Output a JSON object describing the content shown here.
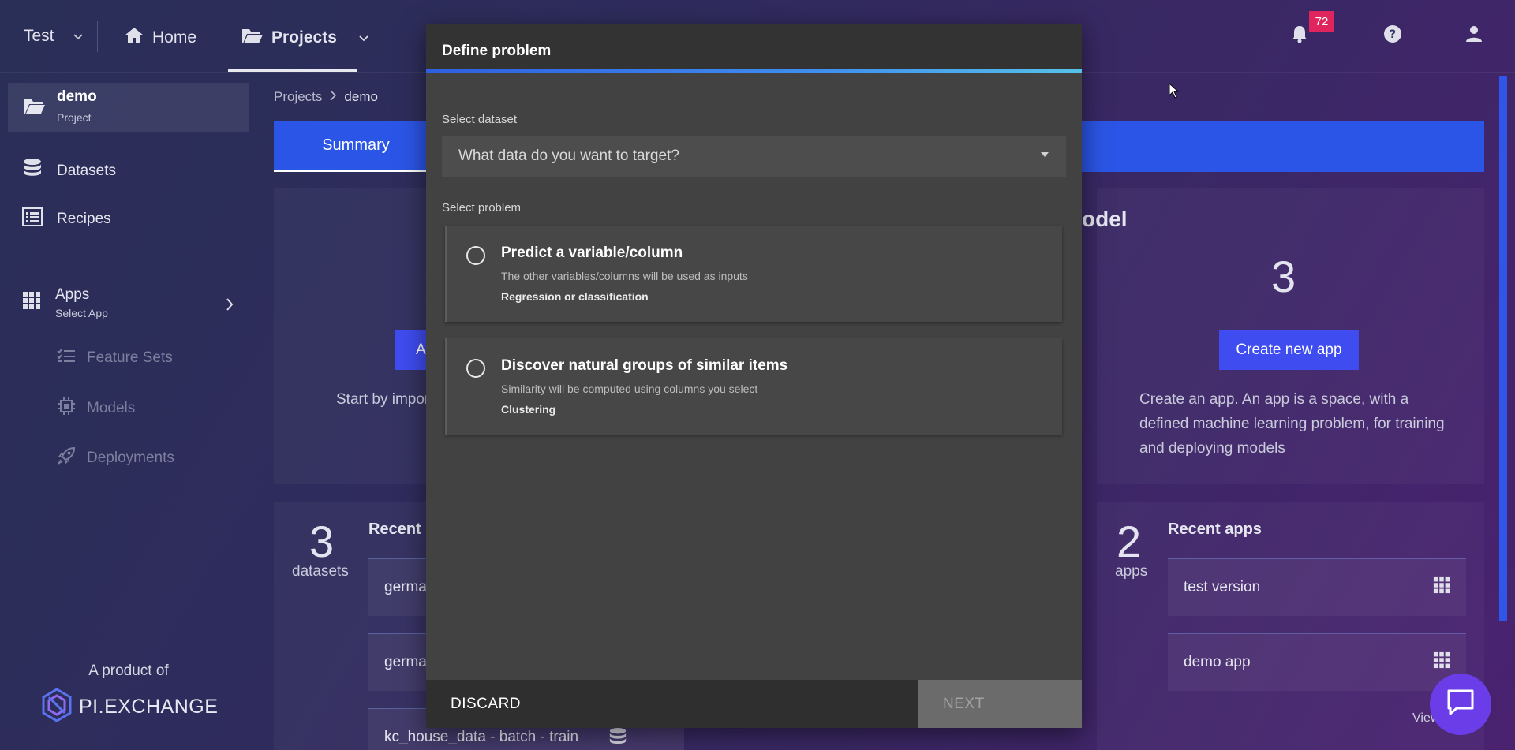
{
  "topbar": {
    "workspace": "Test",
    "home_label": "Home",
    "projects_label": "Projects",
    "notification_count": "72"
  },
  "sidebar": {
    "project_name": "demo",
    "project_type": "Project",
    "datasets_label": "Datasets",
    "recipes_label": "Recipes",
    "apps_label": "Apps",
    "apps_sub": "Select App",
    "feature_sets_label": "Feature Sets",
    "models_label": "Models",
    "deployments_label": "Deployments",
    "footer_text": "A product of",
    "logo_text": "PI.EXCHANGE"
  },
  "breadcrumb": {
    "root": "Projects",
    "current": "demo"
  },
  "tabs": {
    "summary": "Summary"
  },
  "background": {
    "add_button_partial": "A",
    "start_text_partial": "Start by impor",
    "model_heading_partial": "odel",
    "apps_count": "3",
    "create_app_button": "Create new app",
    "create_app_desc": "Create an app. An app is a space, with a defined machine learning problem, for training and deploying models",
    "datasets_count": "3",
    "datasets_unit": "datasets",
    "recent_datasets_partial": "Recent d",
    "dataset_rows": [
      "germa",
      "germa",
      "kc_house_data - batch - train"
    ],
    "recent_apps_count": "2",
    "recent_apps_unit": "apps",
    "recent_apps_title": "Recent apps",
    "app_rows": [
      "test version",
      "demo app"
    ],
    "view_all_partial": "View"
  },
  "modal": {
    "title": "Define problem",
    "dataset_label": "Select dataset",
    "dataset_placeholder": "What data do you want to target?",
    "problem_label": "Select problem",
    "options": [
      {
        "title": "Predict a variable/column",
        "subtitle": "The other variables/columns will be used as inputs",
        "tag": "Regression or classification"
      },
      {
        "title": "Discover natural groups of similar items",
        "subtitle": "Similarity will be computed using columns you select",
        "tag": "Clustering"
      }
    ],
    "discard_label": "DISCARD",
    "next_label": "NEXT"
  },
  "colors": {
    "accent_blue": "#2b55e6",
    "button_blue": "#3f4cf0",
    "badge_red": "#e0245e",
    "modal_bg": "#424242",
    "chat_purple": "#6a3de8"
  }
}
